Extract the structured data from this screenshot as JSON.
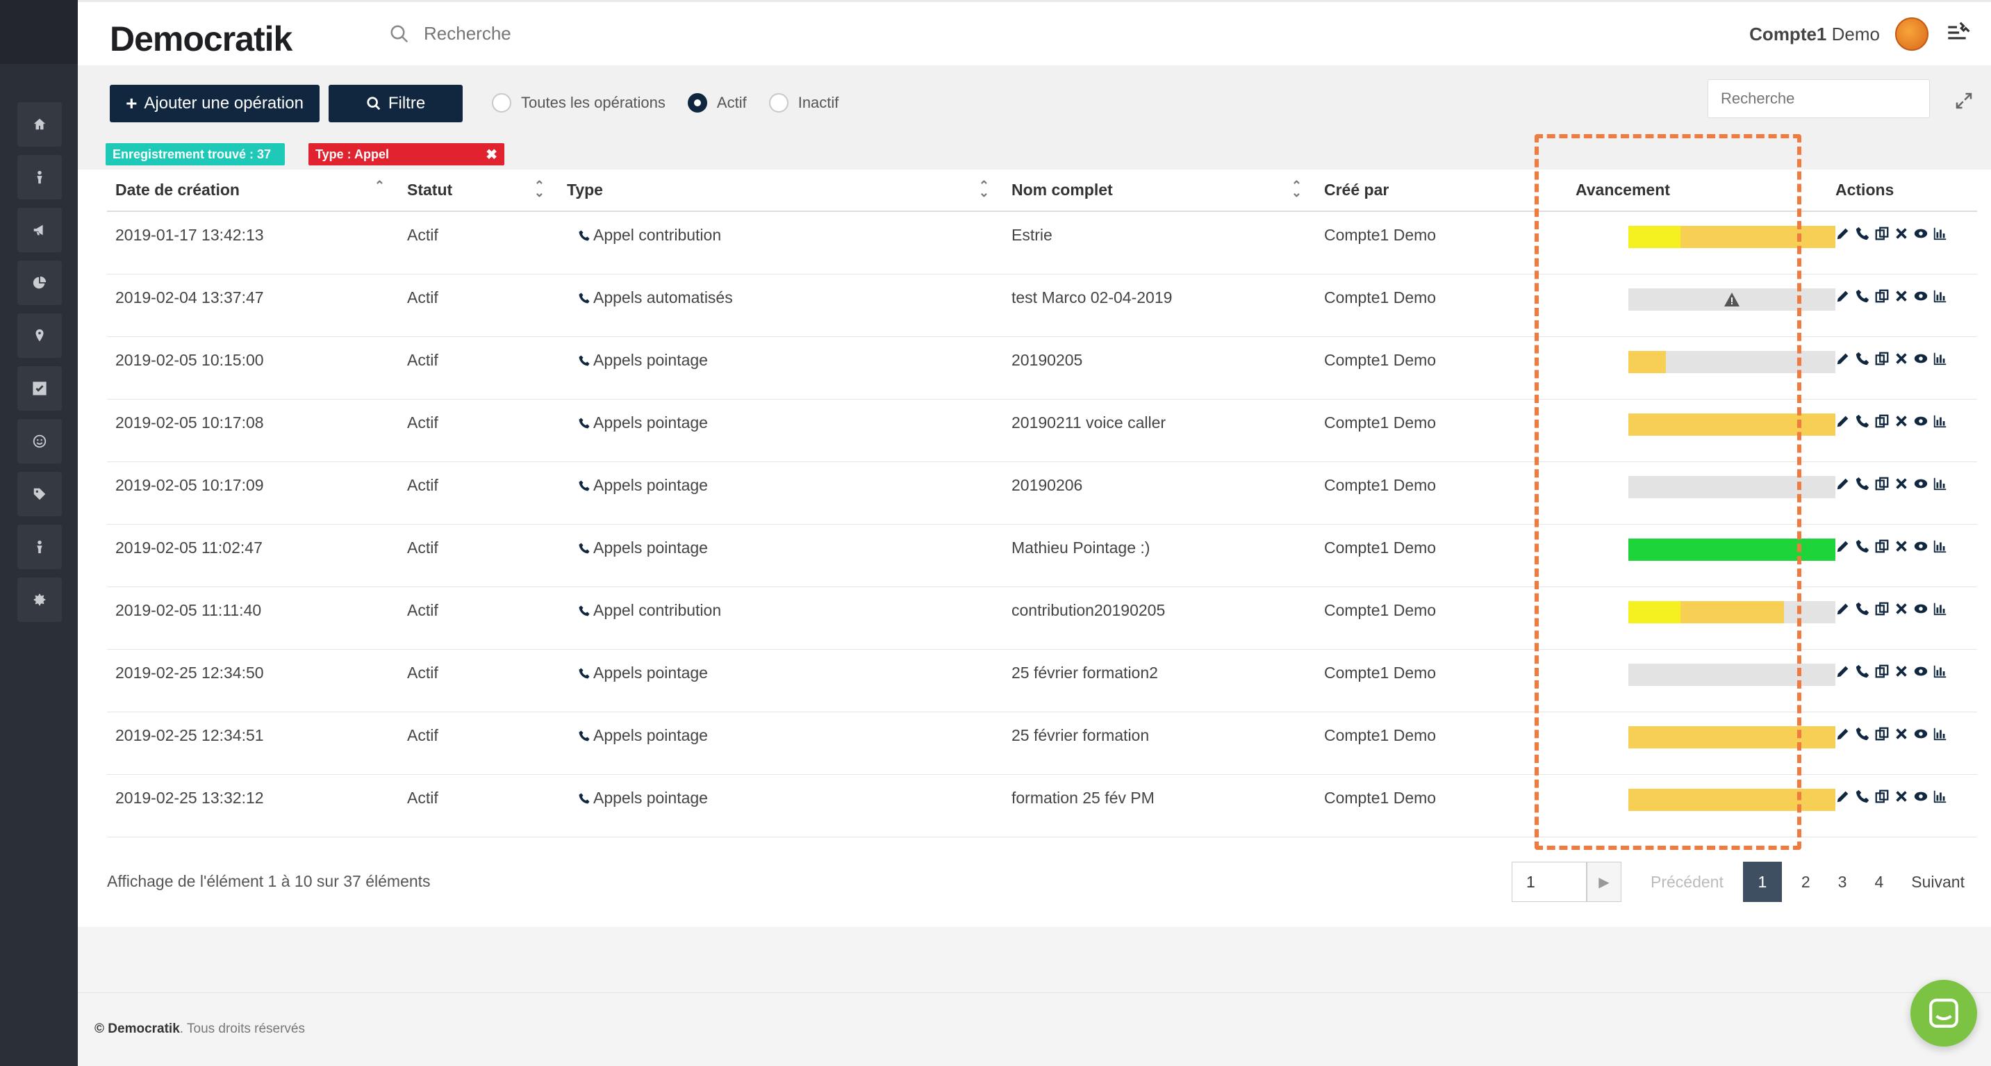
{
  "header": {
    "logo": "Democratik",
    "search_placeholder": "Recherche",
    "user_first": "Compte1",
    "user_last": "Demo"
  },
  "toolbar": {
    "add_label": "Ajouter une opération",
    "filter_label": "Filtre",
    "radio_all": "Toutes les opérations",
    "radio_active": "Actif",
    "radio_inactive": "Inactif",
    "selected_radio": "Actif",
    "right_search_placeholder": "Recherche",
    "badge_count": "Enregistrement trouvé : 37",
    "badge_type": "Type : Appel"
  },
  "table": {
    "columns": [
      "Date de création",
      "Statut",
      "Type",
      "Nom complet",
      "Créé par",
      "Avancement",
      "Actions"
    ],
    "rows": [
      {
        "date": "2019-01-17 13:42:13",
        "statut": "Actif",
        "type": "Appel contribution",
        "nom": "Estrie",
        "cree": "Compte1 Demo",
        "progress": [
          {
            "color": "#f5f121",
            "pct": 0.25
          },
          {
            "color": "#f7cf55",
            "pct": 0.75
          }
        ],
        "warn": false
      },
      {
        "date": "2019-02-04 13:37:47",
        "statut": "Actif",
        "type": "Appels automatisés",
        "nom": "test Marco 02-04-2019",
        "cree": "Compte1 Demo",
        "progress": [],
        "warn": true
      },
      {
        "date": "2019-02-05 10:15:00",
        "statut": "Actif",
        "type": "Appels pointage",
        "nom": "20190205",
        "cree": "Compte1 Demo",
        "progress": [
          {
            "color": "#f7cf55",
            "pct": 0.18
          }
        ],
        "warn": false
      },
      {
        "date": "2019-02-05 10:17:08",
        "statut": "Actif",
        "type": "Appels pointage",
        "nom": "20190211 voice caller",
        "cree": "Compte1 Demo",
        "progress": [
          {
            "color": "#f7cf55",
            "pct": 1.0
          }
        ],
        "warn": false
      },
      {
        "date": "2019-02-05 10:17:09",
        "statut": "Actif",
        "type": "Appels pointage",
        "nom": "20190206",
        "cree": "Compte1 Demo",
        "progress": [],
        "warn": false
      },
      {
        "date": "2019-02-05 11:02:47",
        "statut": "Actif",
        "type": "Appels pointage",
        "nom": "Mathieu Pointage :)",
        "cree": "Compte1 Demo",
        "progress": [
          {
            "color": "#1ed43b",
            "pct": 1.0
          }
        ],
        "warn": false
      },
      {
        "date": "2019-02-05 11:11:40",
        "statut": "Actif",
        "type": "Appel contribution",
        "nom": "contribution20190205",
        "cree": "Compte1 Demo",
        "progress": [
          {
            "color": "#f5f121",
            "pct": 0.25
          },
          {
            "color": "#f7cf55",
            "pct": 0.5
          }
        ],
        "warn": false
      },
      {
        "date": "2019-02-25 12:34:50",
        "statut": "Actif",
        "type": "Appels pointage",
        "nom": "25 février formation2",
        "cree": "Compte1 Demo",
        "progress": [],
        "warn": false
      },
      {
        "date": "2019-02-25 12:34:51",
        "statut": "Actif",
        "type": "Appels pointage",
        "nom": "25 février formation",
        "cree": "Compte1 Demo",
        "progress": [
          {
            "color": "#f7cf55",
            "pct": 1.0
          }
        ],
        "warn": false
      },
      {
        "date": "2019-02-25 13:32:12",
        "statut": "Actif",
        "type": "Appels pointage",
        "nom": "formation 25 fév PM",
        "cree": "Compte1 Demo",
        "progress": [
          {
            "color": "#f7cf55",
            "pct": 1.0
          }
        ],
        "warn": false
      }
    ]
  },
  "pagination": {
    "info": "Affichage de l'élément 1 à 10 sur 37 éléments",
    "input_value": "1",
    "prev": "Précédent",
    "pages": [
      "1",
      "2",
      "3",
      "4"
    ],
    "current": "1",
    "next": "Suivant"
  },
  "footer": {
    "brand": "© Democratik",
    "rights": ". Tous droits réservés"
  },
  "colors": {
    "accent": "#10273f",
    "teal": "#1ec9b8",
    "red": "#e0232e",
    "highlight": "#f17a3e",
    "chat": "#7cc243"
  },
  "icons": [
    "home-icon",
    "person-icon",
    "megaphone-icon",
    "pie-chart-icon",
    "map-pin-icon",
    "checkbox-icon",
    "smiley-icon",
    "tag-icon",
    "person-icon",
    "gear-icon"
  ]
}
